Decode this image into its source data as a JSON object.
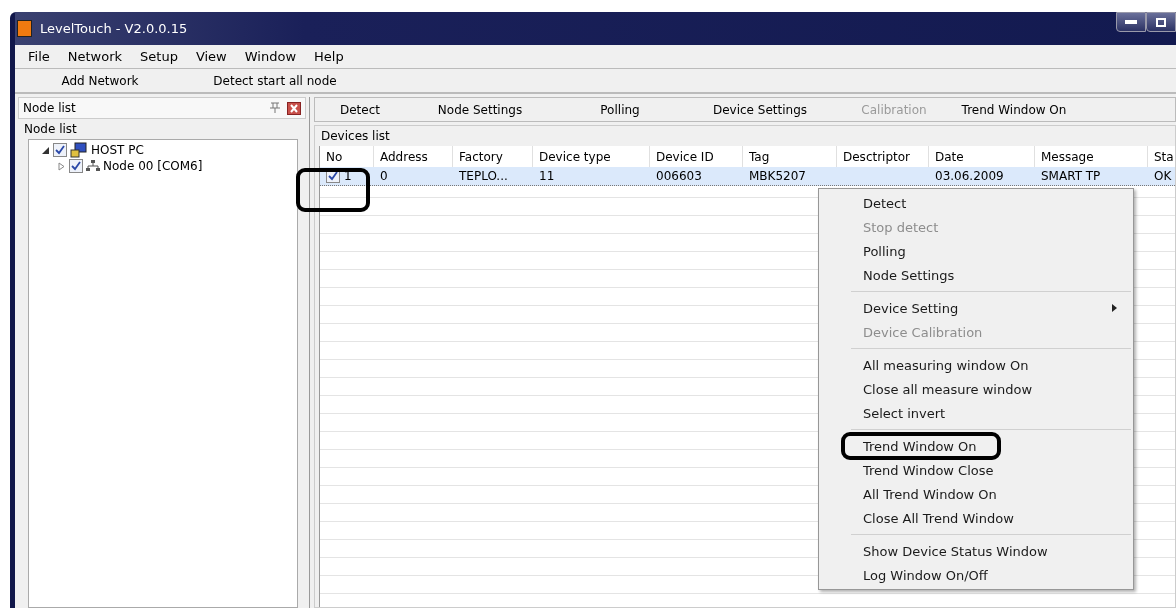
{
  "window": {
    "title": "LevelTouch - V2.0.0.15"
  },
  "menu_bar": [
    "File",
    "Network",
    "Setup",
    "View",
    "Window",
    "Help"
  ],
  "toolbar": [
    "Add Network",
    "Detect start all node"
  ],
  "node_panel": {
    "title": "Node list",
    "group_title": "Node list",
    "tree": [
      {
        "label": "HOST PC",
        "checked": true,
        "expanded": true,
        "children": [
          {
            "label": "Node 00 [COM6]",
            "checked": true,
            "expanded": false
          }
        ]
      }
    ]
  },
  "device_toolbar": [
    {
      "label": "Detect",
      "disabled": false
    },
    {
      "label": "Node Settings",
      "disabled": false
    },
    {
      "label": "Polling",
      "disabled": false
    },
    {
      "label": "Device Settings",
      "disabled": false
    },
    {
      "label": "Calibration",
      "disabled": true
    },
    {
      "label": "Trend Window On",
      "disabled": false
    }
  ],
  "devices": {
    "title": "Devices list",
    "columns": [
      "No",
      "Address",
      "Factory",
      "Device type",
      "Device ID",
      "Tag",
      "Desctriptor",
      "Date",
      "Message",
      "Sta"
    ],
    "rows": [
      {
        "checked": true,
        "selected": true,
        "cells": [
          "1",
          "0",
          "TEPLO...",
          "11",
          "006603",
          "MBK5207",
          "",
          "03.06.2009",
          "SMART TP",
          "OK"
        ]
      }
    ]
  },
  "context_menu": [
    {
      "items": [
        {
          "label": "Detect",
          "disabled": false,
          "submenu": false
        },
        {
          "label": "Stop detect",
          "disabled": true,
          "submenu": false
        },
        {
          "label": "Polling",
          "disabled": false,
          "submenu": false
        },
        {
          "label": "Node Settings",
          "disabled": false,
          "submenu": false
        }
      ]
    },
    {
      "items": [
        {
          "label": "Device Setting",
          "disabled": false,
          "submenu": true
        },
        {
          "label": "Device Calibration",
          "disabled": true,
          "submenu": false
        }
      ]
    },
    {
      "items": [
        {
          "label": "All measuring window On",
          "disabled": false,
          "submenu": false
        },
        {
          "label": "Close all measure window",
          "disabled": false,
          "submenu": false
        },
        {
          "label": "Select invert",
          "disabled": false,
          "submenu": false
        }
      ]
    },
    {
      "items": [
        {
          "label": "Trend Window On",
          "disabled": false,
          "submenu": false,
          "circled": true
        },
        {
          "label": "Trend Window Close",
          "disabled": false,
          "submenu": false
        },
        {
          "label": "All Trend Window On",
          "disabled": false,
          "submenu": false
        },
        {
          "label": "Close All Trend Window",
          "disabled": false,
          "submenu": false
        }
      ]
    },
    {
      "items": [
        {
          "label": "Show Device Status Window",
          "disabled": false,
          "submenu": false
        },
        {
          "label": "Log Window On/Off",
          "disabled": false,
          "submenu": false
        }
      ]
    }
  ]
}
